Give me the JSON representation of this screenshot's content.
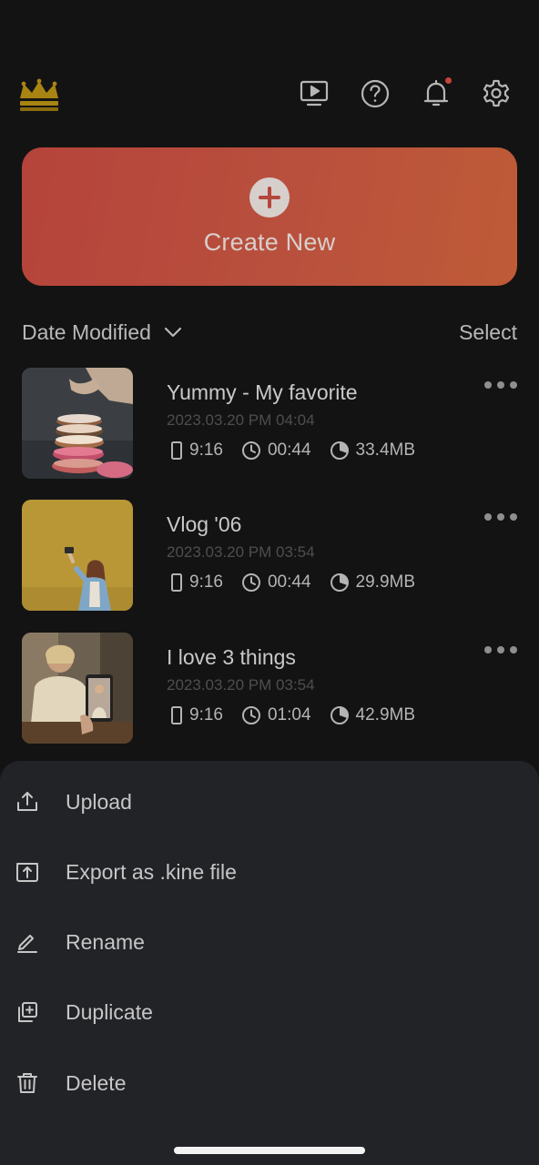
{
  "header": {
    "logo_icon": "crown-logo-icon",
    "icons": [
      "tv-play-icon",
      "help-icon",
      "bell-icon",
      "gear-icon"
    ],
    "notification_dot_color": "#c8423a"
  },
  "create_card": {
    "label": "Create New",
    "icon": "plus-circle-icon",
    "gradient": [
      "#b5433b",
      "#bf5b37"
    ]
  },
  "sort": {
    "label": "Date Modified",
    "select_label": "Select"
  },
  "projects": [
    {
      "title": "Yummy - My favorite",
      "date": "2023.03.20 PM 04:04",
      "ratio": "9:16",
      "duration": "00:44",
      "size": "33.4MB",
      "thumbnail": "stacked-donuts-photo"
    },
    {
      "title": "Vlog '06",
      "date": "2023.03.20 PM 03:54",
      "ratio": "9:16",
      "duration": "00:44",
      "size": "29.9MB",
      "thumbnail": "woman-selfie-yellow-wall-photo"
    },
    {
      "title": "I love 3 things",
      "date": "2023.03.20 PM 03:54",
      "ratio": "9:16",
      "duration": "01:04",
      "size": "42.9MB",
      "thumbnail": "phone-photo-of-woman-photo"
    }
  ],
  "action_sheet": {
    "items": [
      {
        "label": "Upload",
        "icon": "upload-icon"
      },
      {
        "label": "Export as .kine file",
        "icon": "export-box-icon"
      },
      {
        "label": "Rename",
        "icon": "pencil-icon"
      },
      {
        "label": "Duplicate",
        "icon": "duplicate-icon"
      },
      {
        "label": "Delete",
        "icon": "trash-icon"
      }
    ]
  }
}
